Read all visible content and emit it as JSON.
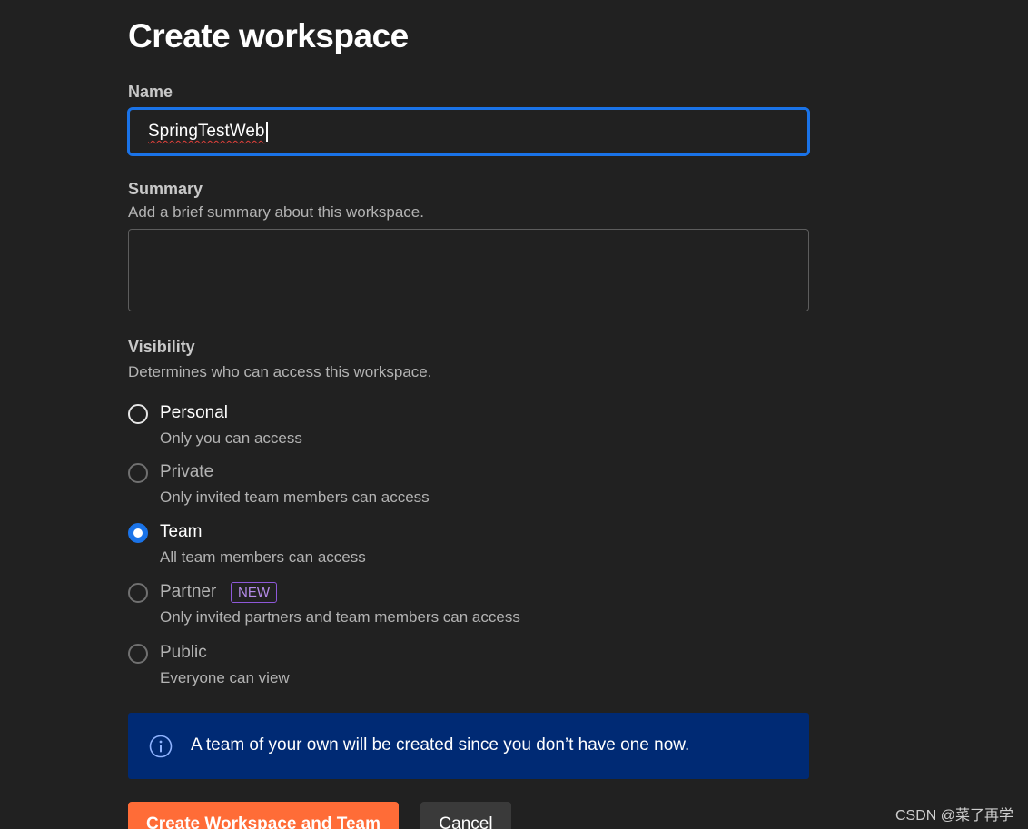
{
  "form": {
    "title": "Create workspace",
    "name": {
      "label": "Name",
      "value": "SpringTestWeb"
    },
    "summary": {
      "label": "Summary",
      "hint": "Add a brief summary about this workspace.",
      "value": ""
    },
    "visibility": {
      "label": "Visibility",
      "hint": "Determines who can access this workspace.",
      "selected": "Team",
      "options": [
        {
          "title": "Personal",
          "description": "Only you can access",
          "checked": false,
          "enabled": true
        },
        {
          "title": "Private",
          "description": "Only invited team members can access",
          "checked": false,
          "enabled": false
        },
        {
          "title": "Team",
          "description": "All team members can access",
          "checked": true,
          "enabled": true
        },
        {
          "title": "Partner",
          "badge": "NEW",
          "description": "Only invited partners and team members can access",
          "checked": false,
          "enabled": false
        },
        {
          "title": "Public",
          "description": "Everyone can view",
          "checked": false,
          "enabled": false
        }
      ]
    },
    "info_banner": {
      "icon": "info-icon",
      "text": "A team of your own will be created since you don’t have one now."
    },
    "actions": {
      "primary_label": "Create Workspace and Team",
      "secondary_label": "Cancel"
    }
  },
  "watermark": "CSDN @菜了再学",
  "colors": {
    "background": "#212121",
    "input_focus_border": "#1a73e8",
    "radio_checked": "#1a73e8",
    "badge_border": "#8e58d9",
    "info_banner_bg": "#002a74",
    "primary_button": "#ff6c37",
    "secondary_button": "#3a3a3a"
  }
}
